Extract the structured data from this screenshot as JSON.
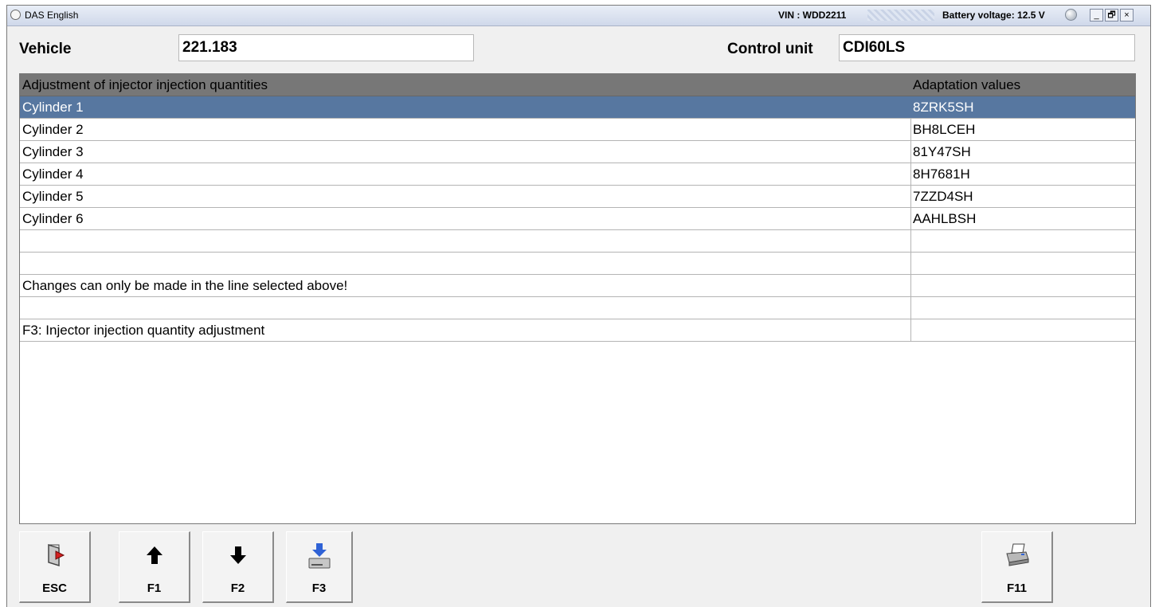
{
  "window": {
    "app_title": "DAS English",
    "vin_label": "VIN : WDD2211",
    "battery_label": "Battery voltage: 12.5 V",
    "minimize_glyph": "_",
    "restore_glyph": "🗗",
    "close_glyph": "×"
  },
  "header": {
    "vehicle_label": "Vehicle",
    "vehicle_value": "221.183",
    "control_unit_label": "Control unit",
    "control_unit_value": "CDI60LS"
  },
  "table": {
    "columns": [
      "Adjustment of injector injection quantities",
      "Adaptation values"
    ],
    "rows": [
      {
        "label": "Cylinder 1",
        "value": "8ZRK5SH"
      },
      {
        "label": "Cylinder 2",
        "value": "BH8LCEH"
      },
      {
        "label": "Cylinder 3",
        "value": "81Y47SH"
      },
      {
        "label": "Cylinder 4",
        "value": "8H7681H"
      },
      {
        "label": "Cylinder 5",
        "value": "7ZZD4SH"
      },
      {
        "label": "Cylinder 6",
        "value": "AAHLBSH"
      },
      {
        "label": "",
        "value": ""
      },
      {
        "label": "",
        "value": ""
      },
      {
        "label": "Changes can only be made in the line selected above!",
        "value": ""
      },
      {
        "label": "",
        "value": ""
      },
      {
        "label": "F3: Injector injection quantity adjustment",
        "value": ""
      }
    ],
    "selected_row": "Cylinder 1"
  },
  "function_keys": [
    {
      "key": "ESC",
      "icon": "exit-door-icon"
    },
    {
      "key": "F1",
      "icon": "arrow-up-icon"
    },
    {
      "key": "F2",
      "icon": "arrow-down-icon"
    },
    {
      "key": "F3",
      "icon": "write-to-device-icon"
    },
    {
      "key": "F11",
      "icon": "printer-icon"
    }
  ],
  "colors": {
    "selected_row": "#5777a0",
    "header_row": "#777777",
    "accent_blue": "#2f62d6"
  }
}
